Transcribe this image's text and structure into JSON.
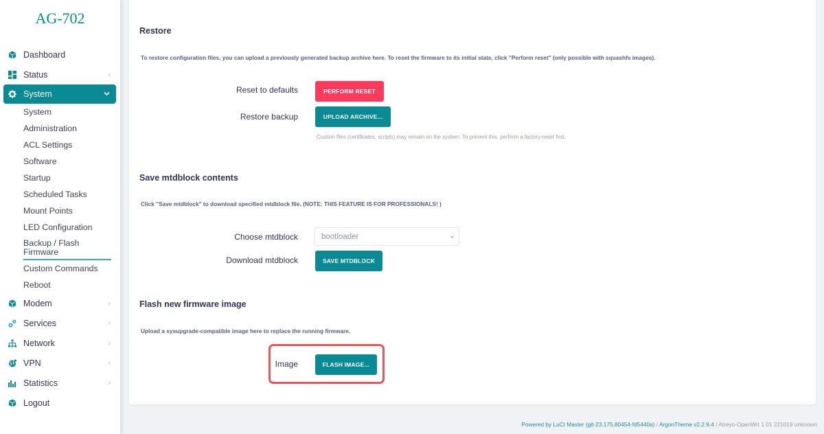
{
  "brand": "AG-702",
  "colors": {
    "accent": "#0a8a94",
    "danger": "#fb3a5e",
    "highlight": "#f05258"
  },
  "sidebar": {
    "items": [
      {
        "label": "Dashboard",
        "icon": "cube-icon",
        "has_children": false
      },
      {
        "label": "Status",
        "icon": "grid-icon",
        "has_children": true,
        "chevron": "›"
      },
      {
        "label": "System",
        "icon": "gear-icon",
        "has_children": true,
        "chevron": "⌄",
        "active": true
      },
      {
        "label": "Modem",
        "icon": "cube-icon",
        "has_children": true,
        "chevron": "›"
      },
      {
        "label": "Services",
        "icon": "cogs-icon",
        "has_children": true,
        "chevron": "›"
      },
      {
        "label": "Network",
        "icon": "sitemap-icon",
        "has_children": true,
        "chevron": "›"
      },
      {
        "label": "VPN",
        "icon": "globe-icon",
        "has_children": true,
        "chevron": "›"
      },
      {
        "label": "Statistics",
        "icon": "bar-chart-icon",
        "has_children": true,
        "chevron": "›"
      },
      {
        "label": "Logout",
        "icon": "cube-icon",
        "has_children": false
      }
    ],
    "system_submenu": [
      "System",
      "Administration",
      "ACL Settings",
      "Software",
      "Startup",
      "Scheduled Tasks",
      "Mount Points",
      "LED Configuration",
      "Backup / Flash Firmware",
      "Custom Commands",
      "Reboot"
    ],
    "current_submenu": "Backup / Flash Firmware"
  },
  "restore": {
    "title": "Restore",
    "description": "To restore configuration files, you can upload a previously generated backup archive here. To reset the firmware to its initial state, click \"Perform reset\" (only possible with squashfs images).",
    "reset_label": "Reset to defaults",
    "reset_button": "PERFORM RESET",
    "backup_label": "Restore backup",
    "upload_button": "UPLOAD ARCHIVE...",
    "hint": "Custom files (certificates, scripts) may remain on the system. To prevent this, perform a factory-reset first."
  },
  "mtdblock": {
    "title": "Save mtdblock contents",
    "description": "Click \"Save mtdblock\" to download specified mtdblock file. (NOTE: THIS FEATURE IS FOR PROFESSIONALS! )",
    "choose_label": "Choose mtdblock",
    "choose_value": "bootloader",
    "download_label": "Download mtdblock",
    "save_button": "SAVE MTDBLOCK"
  },
  "flash": {
    "title": "Flash new firmware image",
    "description": "Upload a sysupgrade-compatible image here to replace the running firmware.",
    "image_label": "Image",
    "flash_button": "FLASH IMAGE..."
  },
  "footer": {
    "luci": "Powered by LuCI Master (git-23.175.80454-fd5440a)",
    "sep": " / ",
    "theme": "ArgonTheme v2.2.9.4",
    "sep2": " / ",
    "build": "Atreyo-OpenWrt 1.01 221019 unknown"
  }
}
